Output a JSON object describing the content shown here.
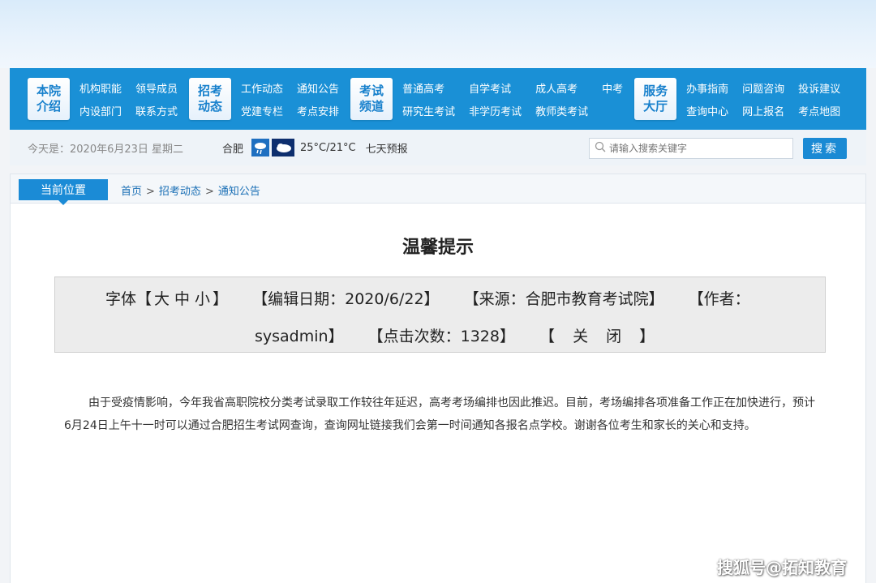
{
  "nav": {
    "groups": [
      {
        "badge": "本院介绍",
        "links": [
          "机构职能",
          "内设部门",
          "领导成员",
          "联系方式"
        ]
      },
      {
        "badge": "招考动态",
        "links": [
          "工作动态",
          "党建专栏",
          "通知公告",
          "考点安排"
        ]
      },
      {
        "badge": "考试频道",
        "links": [
          "普通高考",
          "研究生考试",
          "自学考试",
          "非学历考试",
          "成人高考",
          "教师类考试",
          "中考"
        ]
      },
      {
        "badge": "服务大厅",
        "links": [
          "办事指南",
          "查询中心",
          "问题咨询",
          "网上报名",
          "投诉建议",
          "考点地图"
        ]
      }
    ]
  },
  "infobar": {
    "today": "今天是：2020年6月23日 星期二",
    "city": "合肥",
    "weather_icons": [
      "rain-icon",
      "cloudy-icon"
    ],
    "temperature": "25°C/21°C",
    "forecast_link": "七天预报",
    "search_placeholder": "请输入搜索关键字",
    "search_button": "搜索"
  },
  "breadcrumb": {
    "tab_label": "当前位置",
    "items": [
      "首页",
      "招考动态",
      "通知公告"
    ],
    "separator": ">"
  },
  "article": {
    "title": "温馨提示",
    "meta": {
      "font_label_open": "字体【",
      "font_sizes": [
        "大",
        "中",
        "小"
      ],
      "font_label_close": "】",
      "edit_date": "【编辑日期：2020/6/22】",
      "source": "【来源：合肥市教育考试院】",
      "author_open": "【作者：",
      "author_name": "sysadmin】",
      "clicks": "【点击次数：1328】",
      "close": "【 关 闭 】"
    },
    "body": "由于受疫情影响，今年我省高职院校分类考试录取工作较往年延迟，高考考场编排也因此推迟。目前，考场编排各项准备工作正在加快进行，预计6月24日上午十一时可以通过合肥招生考试网查询，查询网址链接我们会第一时间通知各报名点学校。谢谢各位考生和家长的关心和支持。"
  },
  "watermark": "搜狐号@拓知教育",
  "colors": {
    "nav_blue": "#1a90d6",
    "badge_text": "#1780cc",
    "button_blue": "#1a8ad4"
  }
}
